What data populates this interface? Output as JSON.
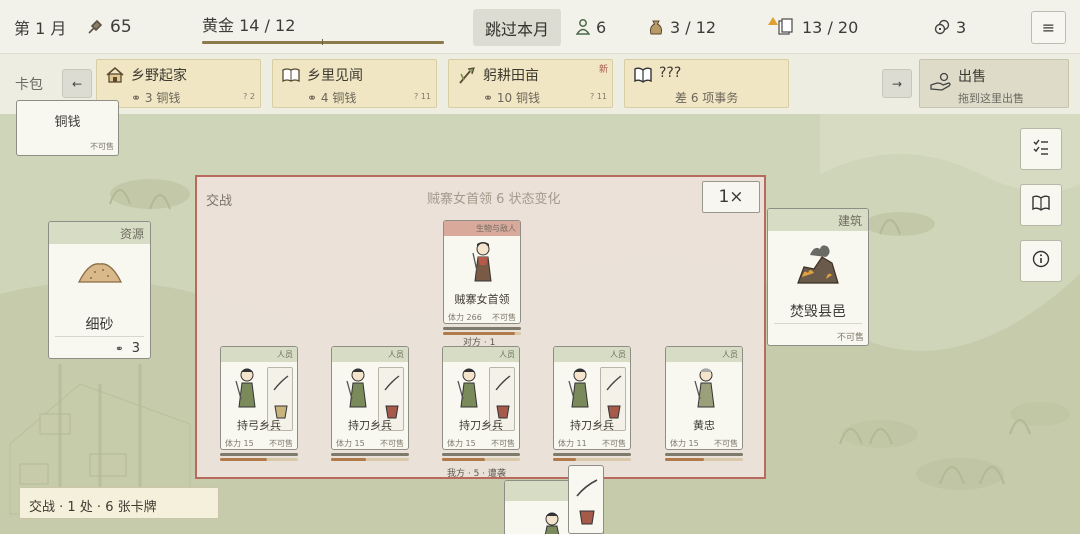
{
  "topbar": {
    "month": "第 1 月",
    "influence": "65",
    "gold_label": "黄金 14 / 12",
    "gold_progress": 1.0,
    "skip_button": "跳过本月",
    "population": "6",
    "food": "3 / 12",
    "cards": "13 / 20",
    "coins": "3",
    "menu_icon": "hamburger-icon"
  },
  "packbar": {
    "label": "卡包",
    "packs": [
      {
        "name": "乡野起家",
        "cost": "3 铜钱",
        "count": "? 2",
        "icon": "house-icon",
        "new": ""
      },
      {
        "name": "乡里见闻",
        "cost": "4 铜钱",
        "count": "? 11",
        "icon": "scroll-icon",
        "new": ""
      },
      {
        "name": "躬耕田亩",
        "cost": "10 铜钱",
        "count": "? 11",
        "icon": "hoe-icon",
        "new": "新"
      },
      {
        "name": "???",
        "cost": "差 6 项事务",
        "count": "",
        "icon": "book-icon",
        "new": ""
      }
    ],
    "sell": {
      "label": "出售",
      "sub": "拖到这里出售"
    }
  },
  "board": {
    "copper_card": {
      "name": "铜钱",
      "foot": "不可售"
    },
    "sand_card": {
      "type": "资源",
      "name": "细砂",
      "value": "3"
    },
    "building_card": {
      "type": "建筑",
      "name": "焚毁县邑",
      "foot": "不可售"
    }
  },
  "combat": {
    "label": "交战",
    "title": "贼寨女首领 6 状态变化",
    "speed": "1×",
    "enemy": {
      "type": "生物与敌人",
      "name": "贼寨女首领",
      "hp": "体力 266",
      "foot": "不可售",
      "hp_fraction": 0.92
    },
    "enemy_side_label": "对方 · 1",
    "allies": [
      {
        "type": "人员",
        "name": "持弓乡兵",
        "hp": "体力 15",
        "foot": "不可售",
        "hp_fraction": 0.6
      },
      {
        "type": "人员",
        "name": "持刀乡兵",
        "hp": "体力 15",
        "foot": "不可售",
        "hp_fraction": 0.45
      },
      {
        "type": "人员",
        "name": "持刀乡兵",
        "hp": "体力 15",
        "foot": "不可售",
        "hp_fraction": 0.55
      },
      {
        "type": "人员",
        "name": "持刀乡兵",
        "hp": "体力 11",
        "foot": "不可售",
        "hp_fraction": 0.3
      },
      {
        "type": "人员",
        "name": "黄忠",
        "hp": "体力 15",
        "foot": "不可售",
        "hp_fraction": 0.5
      }
    ],
    "ally_side_label": "我方 · 5 · 遭袭"
  },
  "status": "交战 · 1 处 · 6 张卡牌",
  "colors": {
    "combat_border": "#b86a5e",
    "pack_bg": "#f1e6c4",
    "topbar_bg": "#f3f2ea"
  }
}
